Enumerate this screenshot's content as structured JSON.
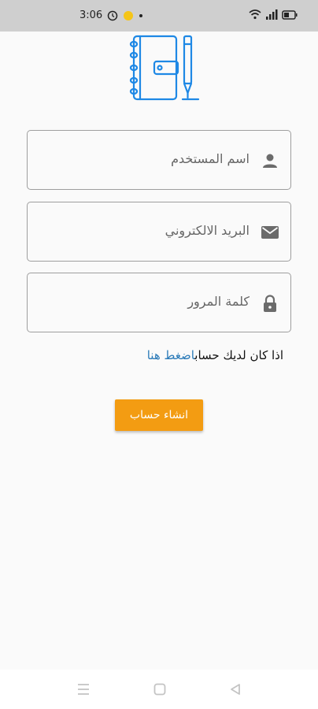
{
  "status_bar": {
    "time": "3:06",
    "icons": [
      "alarm-icon",
      "notification-dot-icon",
      "wifi-icon",
      "signal-icon",
      "battery-icon"
    ]
  },
  "logo": {
    "icon": "notebook-pen-icon",
    "color": "#1e88e5"
  },
  "form": {
    "username_placeholder": "اسم المستخدم",
    "email_placeholder": "البريد الالكتروني",
    "password_placeholder": "كلمة المرور"
  },
  "login_prompt": {
    "text": "اذا كان لديك حساب",
    "link": "اضغط هنا"
  },
  "create_button": {
    "label": "انشاء حساب",
    "color": "#f39c12"
  },
  "nav_bar": {
    "icons": [
      "menu-icon",
      "home-square-icon",
      "back-triangle-icon"
    ]
  }
}
